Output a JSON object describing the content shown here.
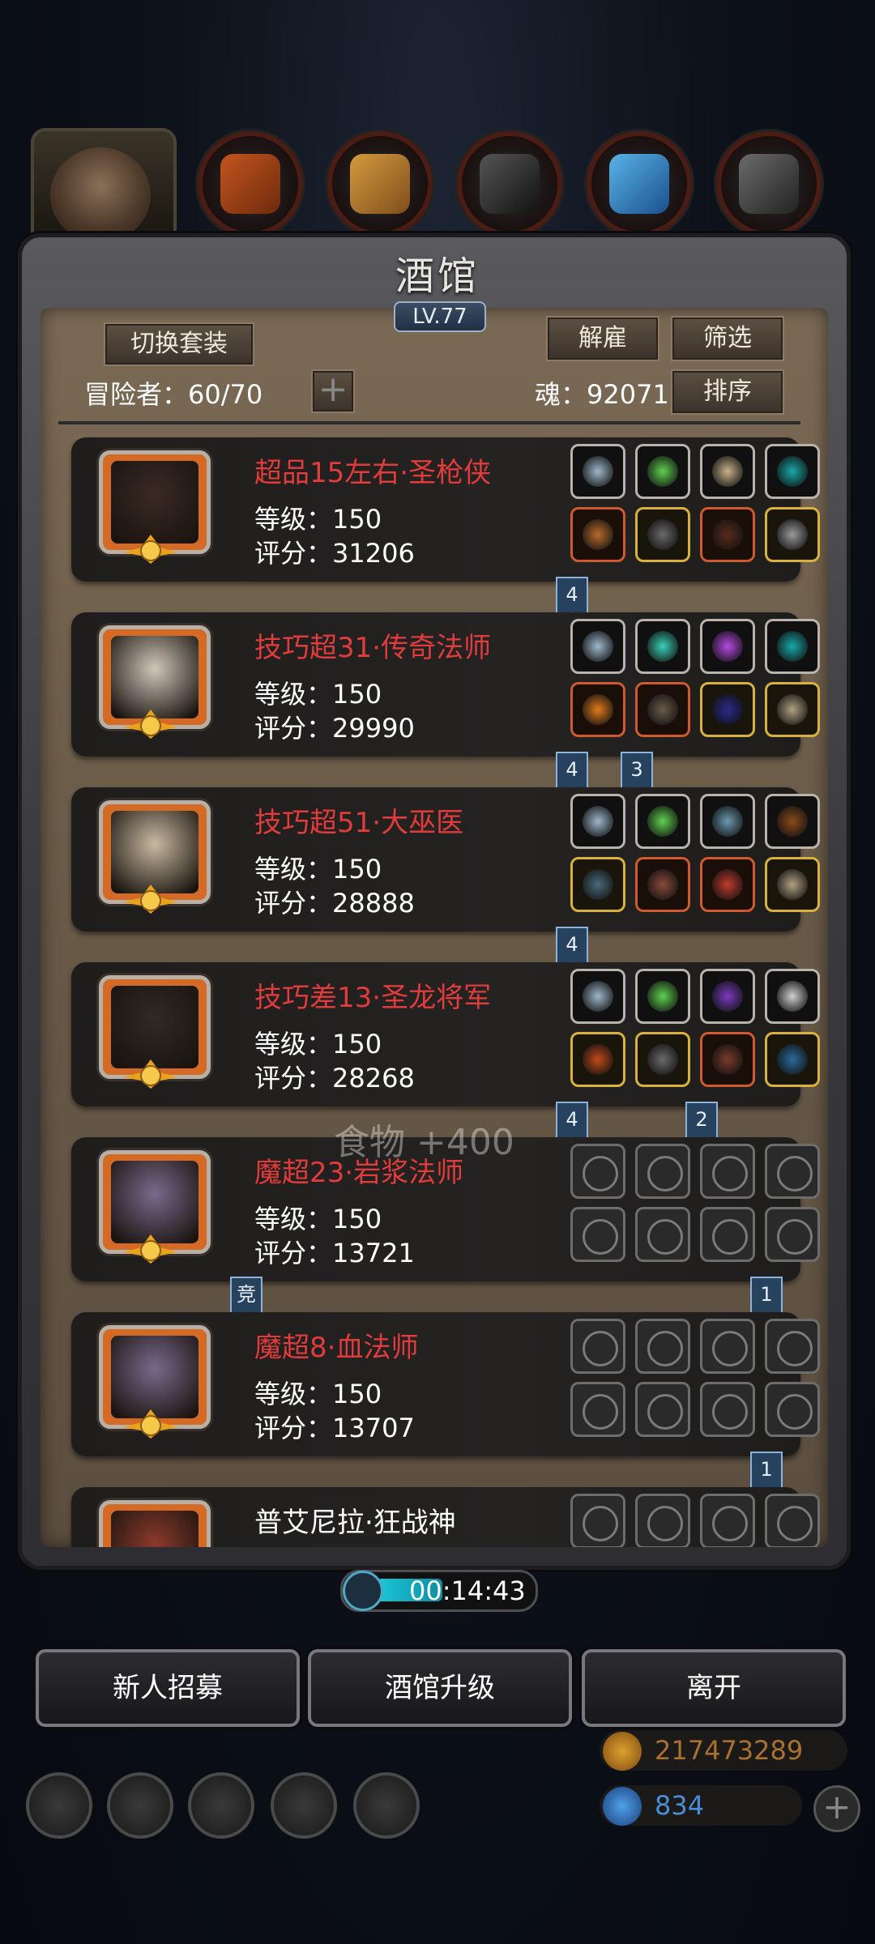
{
  "header": {
    "title": "酒馆",
    "level": "LV.77",
    "switch_set_label": "切换套装",
    "dismiss_label": "解雇",
    "filter_label": "筛选",
    "sort_label": "排序",
    "adventurers_label": "冒险者：60/70",
    "soul_label": "魂：92071",
    "add_label": "+"
  },
  "tabs": [
    {
      "name": "portrait-tab"
    },
    {
      "name": "leather-tab"
    },
    {
      "name": "wood-tab"
    },
    {
      "name": "metal-tab"
    },
    {
      "name": "crystal-tab"
    },
    {
      "name": "iron-tab"
    }
  ],
  "heroes": [
    {
      "name": "超品15左右·圣枪侠",
      "name_color": "#e03c3c",
      "level": "等级：150",
      "score": "评分：31206",
      "ribbons": [
        "4"
      ],
      "ribbons_pos": [
        "slot2"
      ],
      "slots_empty": false
    },
    {
      "name": "技巧超31·传奇法师",
      "name_color": "#e03c3c",
      "level": "等级：150",
      "score": "评分：29990",
      "ribbons": [
        "4",
        "3"
      ],
      "slots_empty": false
    },
    {
      "name": "技巧超51·大巫医",
      "name_color": "#e03c3c",
      "level": "等级：150",
      "score": "评分：28888",
      "ribbons": [
        "4"
      ],
      "slots_empty": false
    },
    {
      "name": "技巧差13·圣龙将军",
      "name_color": "#e03c3c",
      "level": "等级：150",
      "score": "评分：28268",
      "ribbons": [
        "4",
        "2"
      ],
      "slots_empty": false
    },
    {
      "name": "魔超23·岩浆法师",
      "name_color": "#e03c3c",
      "level": "等级：150",
      "score": "评分：13721",
      "ribbons": [
        "竞",
        "1"
      ],
      "slots_empty": true
    },
    {
      "name": "魔超8·血法师",
      "name_color": "#e03c3c",
      "level": "等级：150",
      "score": "评分：13707",
      "ribbons": [
        "1"
      ],
      "slots_empty": true
    },
    {
      "name": "普艾尼拉·狂战神",
      "name_color": "#ffffff",
      "level": "",
      "score": "",
      "ribbons": [],
      "slots_empty": true
    }
  ],
  "floating_text": "食物 +400",
  "timer": {
    "text": "00:14:43",
    "progress": 0.45
  },
  "bottom_buttons": {
    "recruit": "新人招募",
    "upgrade": "酒馆升级",
    "leave": "离开"
  },
  "resources": {
    "gold": "217473289",
    "gems": "834"
  },
  "colors": {
    "accent_red": "#e03c3c",
    "panel_brown": "#6b5c49",
    "ribbon_blue": "#27425f"
  }
}
